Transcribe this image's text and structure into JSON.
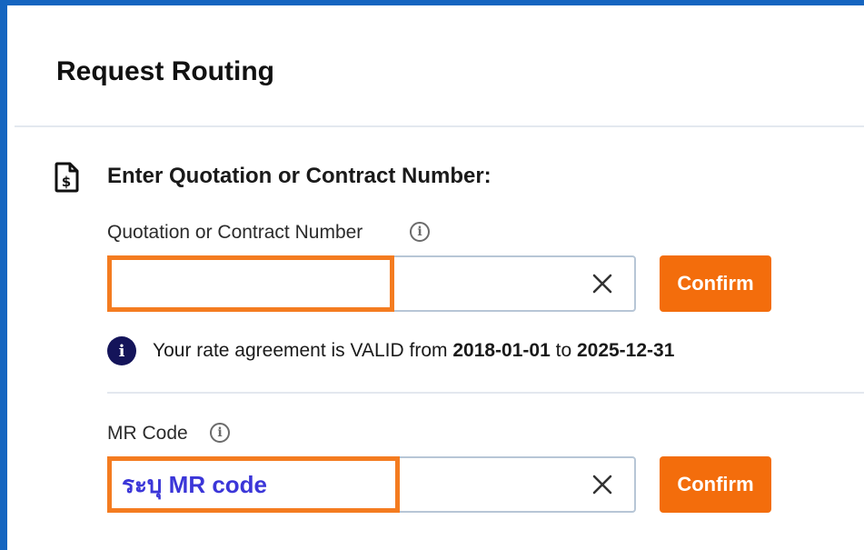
{
  "panel": {
    "title": "Request Routing"
  },
  "section": {
    "heading": "Enter Quotation or Contract Number:",
    "icon": "dollar-document-icon"
  },
  "quotation_field": {
    "label": "Quotation or Contract Number",
    "value": "",
    "placeholder": "",
    "confirm_label": "Confirm"
  },
  "validity": {
    "prefix": "Your rate agreement is VALID from",
    "start_date": "2018-01-01",
    "connector": "to",
    "end_date": "2025-12-31"
  },
  "mr_field": {
    "label": "MR Code",
    "value": "",
    "placeholder": "ระบุ MR code",
    "confirm_label": "Confirm"
  },
  "colors": {
    "frame": "#1565c0",
    "highlight": "#f47c20",
    "button": "#f36d0c",
    "info_badge": "#14145a",
    "annotation_text": "#3b36d8"
  }
}
